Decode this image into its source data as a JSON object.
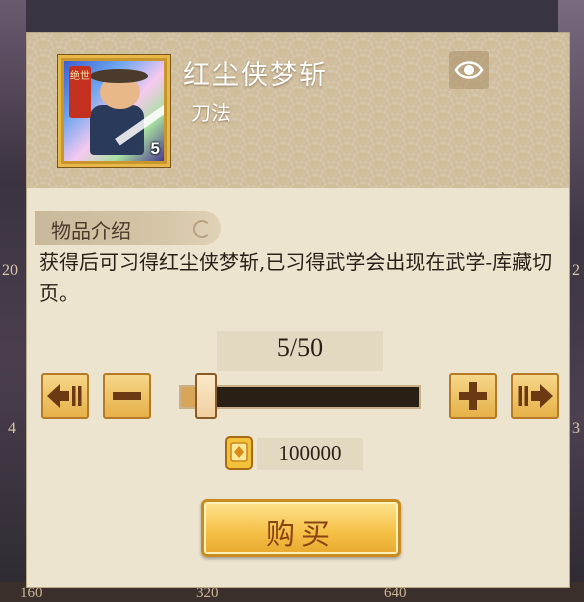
{
  "item": {
    "name": "红尘侠梦斩",
    "type": "刀法",
    "level": "5",
    "seal_text": "绝世"
  },
  "section": {
    "title": "物品介绍"
  },
  "description": "获得后可习得红尘侠梦斩,已习得武学会出现在武学-库藏切页。",
  "quantity": {
    "display": "5/50",
    "current": 5,
    "max": 50
  },
  "price": {
    "amount": "100000",
    "currency_icon": "gold-ingot-coin-icon"
  },
  "buy_label": "购买",
  "background_numbers": {
    "bottom": [
      "160",
      "320",
      "640"
    ],
    "side": [
      "20",
      "4",
      "2",
      "3"
    ]
  },
  "icons": {
    "preview": "eye-icon",
    "min": "arrow-left-bar-icon",
    "decrease": "minus-icon",
    "increase": "plus-icon",
    "max": "arrow-right-bar-icon"
  },
  "colors": {
    "panel_bg": "#ede4d0",
    "header_bg": "#cfbd9c",
    "button_gold": "#f6c24a",
    "text_dark": "#2a2018"
  }
}
